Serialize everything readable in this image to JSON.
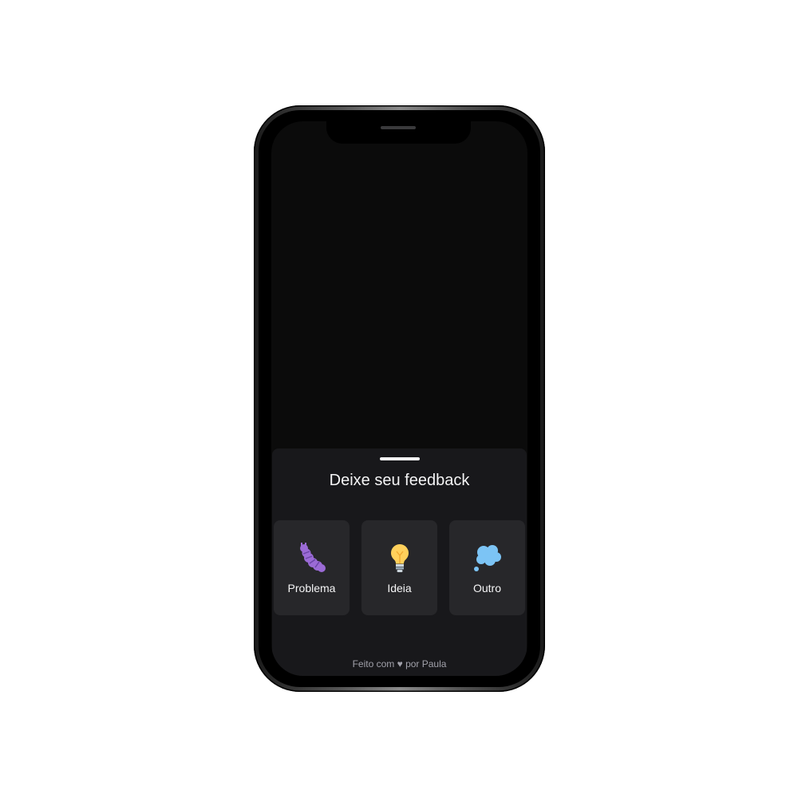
{
  "widget": {
    "title": "Deixe seu feedback",
    "options": [
      {
        "label": "Problema",
        "icon": "bug-icon"
      },
      {
        "label": "Ideia",
        "icon": "lightbulb-icon"
      },
      {
        "label": "Outro",
        "icon": "thought-bubble-icon"
      }
    ],
    "footer": {
      "prefix": "Feito com",
      "heart": "♥",
      "suffix": "por Paula"
    }
  },
  "colors": {
    "panel": "#18181b",
    "card": "#27272a",
    "bug": "#9b6bd6",
    "bulb": "#ffd05b",
    "cloud": "#7cc4f5"
  }
}
